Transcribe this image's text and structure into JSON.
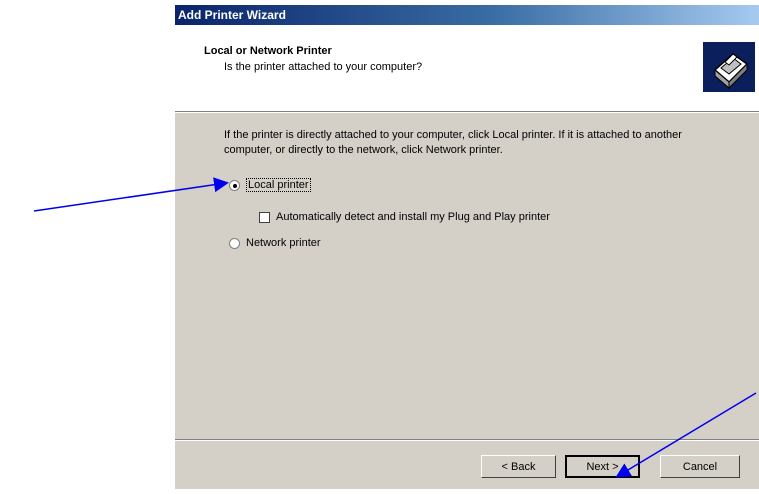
{
  "window": {
    "title": "Add Printer Wizard"
  },
  "header": {
    "title": "Local or Network Printer",
    "subtitle": "Is the printer attached to your computer?",
    "icon": "printer-icon"
  },
  "body": {
    "description": "If the printer is directly attached to your computer, click Local printer. If it is attached to another computer, or directly to the network, click Network printer.",
    "options": {
      "local": {
        "label": "Local printer",
        "selected": true
      },
      "auto_detect": {
        "label": "Automatically detect and install my Plug and Play printer",
        "checked": false
      },
      "network": {
        "label": "Network printer",
        "selected": false
      }
    }
  },
  "buttons": {
    "back": "< Back",
    "next": "Next >",
    "cancel": "Cancel"
  },
  "colors": {
    "titlebar_start": "#0a246a",
    "titlebar_end": "#a6caf0",
    "dialog_bg": "#d4d0c8",
    "annotation_arrow": "#0000ee"
  }
}
